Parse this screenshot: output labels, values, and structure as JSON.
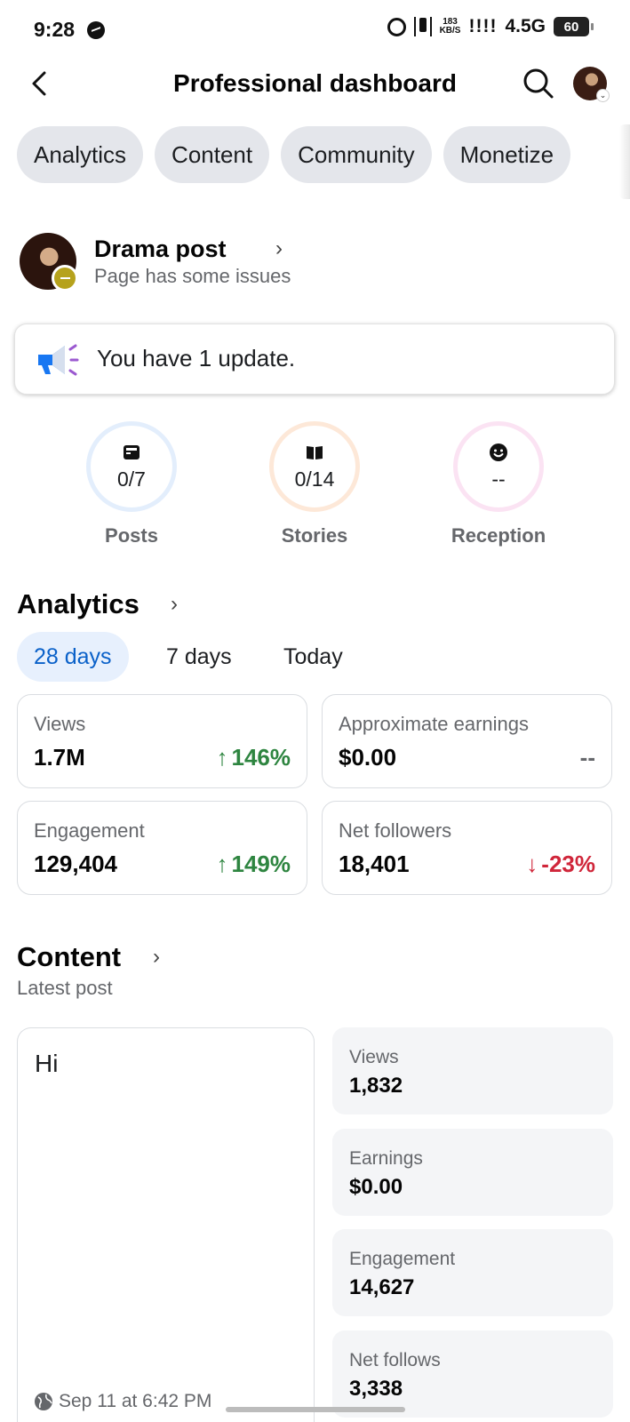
{
  "status_bar": {
    "time": "9:28",
    "speed_top": "183",
    "speed_bottom": "KB/S",
    "signal": "!!!!",
    "network": "4.5G",
    "battery": "60"
  },
  "header": {
    "title": "Professional dashboard"
  },
  "tabs": [
    "Analytics",
    "Content",
    "Community",
    "Monetize"
  ],
  "page": {
    "name": "Drama post",
    "status": "Page has some issues"
  },
  "update": {
    "text": "You have 1 update."
  },
  "rings": [
    {
      "value": "0/7",
      "label": "Posts",
      "icon": "post-icon",
      "color": "#e3eefc"
    },
    {
      "value": "0/14",
      "label": "Stories",
      "icon": "book-icon",
      "color": "#fde8d8"
    },
    {
      "value": "--",
      "label": "Reception",
      "icon": "smiley-icon",
      "color": "#fbe3f3"
    }
  ],
  "analytics": {
    "title": "Analytics",
    "ranges": [
      "28 days",
      "7 days",
      "Today"
    ],
    "active_range": "28 days",
    "metrics": [
      {
        "label": "Views",
        "value": "1.7M",
        "change": "146%",
        "direction": "up"
      },
      {
        "label": "Approximate earnings",
        "value": "$0.00",
        "change": "--",
        "direction": "none"
      },
      {
        "label": "Engagement",
        "value": "129,404",
        "change": "149%",
        "direction": "up"
      },
      {
        "label": "Net followers",
        "value": "18,401",
        "change": "-23%",
        "direction": "down"
      }
    ]
  },
  "content": {
    "title": "Content",
    "subtitle": "Latest post",
    "post_text": "Hi",
    "post_date": "Sep 11 at 6:42 PM",
    "stats": [
      {
        "label": "Views",
        "value": "1,832"
      },
      {
        "label": "Earnings",
        "value": "$0.00"
      },
      {
        "label": "Engagement",
        "value": "14,627"
      },
      {
        "label": "Net follows",
        "value": "3,338"
      }
    ]
  },
  "colors": {
    "accent": "#0a61c9",
    "positive": "#2e8540",
    "negative": "#d0263a",
    "chip_bg": "#e4e6eb"
  }
}
